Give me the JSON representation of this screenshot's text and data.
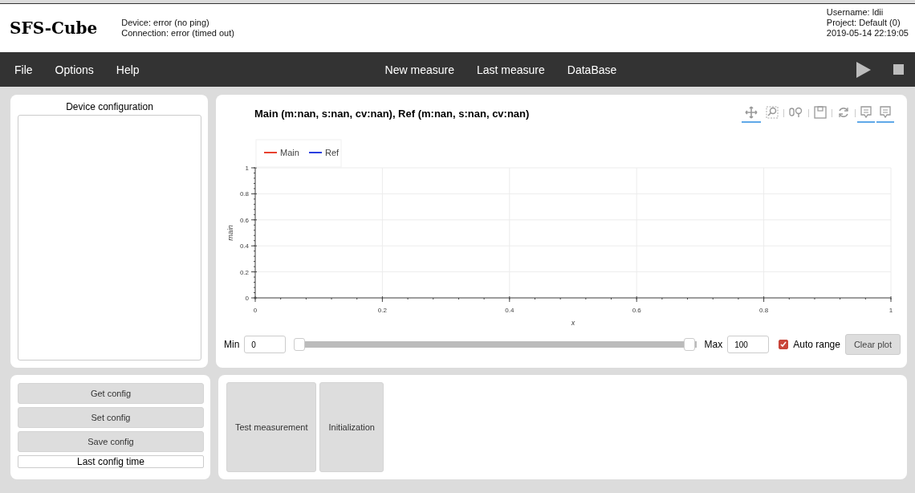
{
  "header": {
    "logo": "SFS-Cube",
    "status": [
      "Device: error (no ping)",
      "Connection: error (timed out)"
    ],
    "info": [
      "Username: ldii",
      "Project: Default (0)",
      "2019-05-14 22:19:05"
    ]
  },
  "menu": [
    "File",
    "Options",
    "Help"
  ],
  "nav": [
    "New measure",
    "Last measure",
    "DataBase"
  ],
  "controls": [
    {
      "kind": "play"
    },
    {
      "kind": "stop"
    }
  ],
  "device_panel": {
    "title": "Device configuration"
  },
  "plot": {
    "title": "Main (m:nan, s:nan, cv:nan), Ref (m:nan, s:nan, cv:nan)",
    "tools": [
      {
        "kind": "pan",
        "selected": true
      },
      {
        "kind": "box-zoom",
        "selected": false
      },
      {
        "kind": "wheel-zoom",
        "selected": false
      },
      {
        "kind": "save",
        "selected": false
      },
      {
        "kind": "reset",
        "selected": false
      },
      {
        "kind": "hover",
        "selected": true
      },
      {
        "kind": "hover",
        "selected": true
      }
    ],
    "chart_data": {
      "type": "line",
      "xlabel": "x",
      "ylabel": "main",
      "series": [
        {
          "name": "Main",
          "color": "#e8412f",
          "values": [
            null,
            null,
            null,
            null,
            null,
            null
          ]
        },
        {
          "name": "Ref",
          "color": "#2a3fe0",
          "values": [
            null,
            null,
            null,
            null,
            null,
            null
          ]
        }
      ],
      "categories": [
        "0",
        "0.2",
        "0.4",
        "0.6",
        "0.8",
        "1"
      ],
      "ylim": [
        0,
        1
      ],
      "yticks": [
        0,
        0.2,
        0.4,
        0.6,
        0.8,
        1
      ],
      "grid": true
    }
  },
  "range": {
    "min_label": "Min",
    "min_value": "0",
    "handles": [
      {
        "level": 0
      },
      {
        "level": 1
      }
    ],
    "max_label": "Max",
    "max_value": "100",
    "auto_range": {
      "label": "Auto range",
      "checked": true
    },
    "clear_button": "Clear plot"
  },
  "config_buttons": [
    "Get config",
    "Set config",
    "Save config"
  ],
  "last_config": "Last config time",
  "actions": [
    "Test measurement",
    "Initialization"
  ]
}
